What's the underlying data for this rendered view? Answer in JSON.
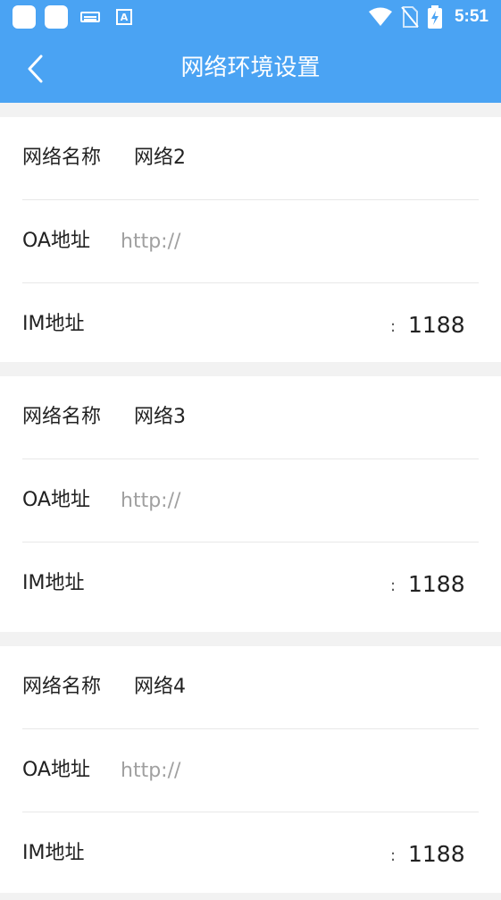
{
  "status_bar": {
    "time": "5:51",
    "keyboard_badge": "A",
    "icons": [
      "square-icon",
      "square-icon",
      "keyboard-icon",
      "a-badge-icon",
      "wifi-icon",
      "no-sim-icon",
      "battery-charging-icon"
    ]
  },
  "header": {
    "title": "网络环境设置",
    "back_icon": "chevron-left-icon",
    "background": "#4aa3f3"
  },
  "networks": [
    {
      "name_label": "网络名称",
      "name_value": "网络2",
      "oa_label": "OA地址",
      "oa_placeholder": "http://",
      "im_label": "IM地址",
      "colon": ":",
      "im_port": "1188"
    },
    {
      "name_label": "网络名称",
      "name_value": "网络3",
      "oa_label": "OA地址",
      "oa_placeholder": "http://",
      "im_label": "IM地址",
      "colon": ":",
      "im_port": "1188"
    },
    {
      "name_label": "网络名称",
      "name_value": "网络4",
      "oa_label": "OA地址",
      "oa_placeholder": "http://",
      "im_label": "IM地址",
      "colon": ":",
      "im_port": "1188"
    }
  ]
}
